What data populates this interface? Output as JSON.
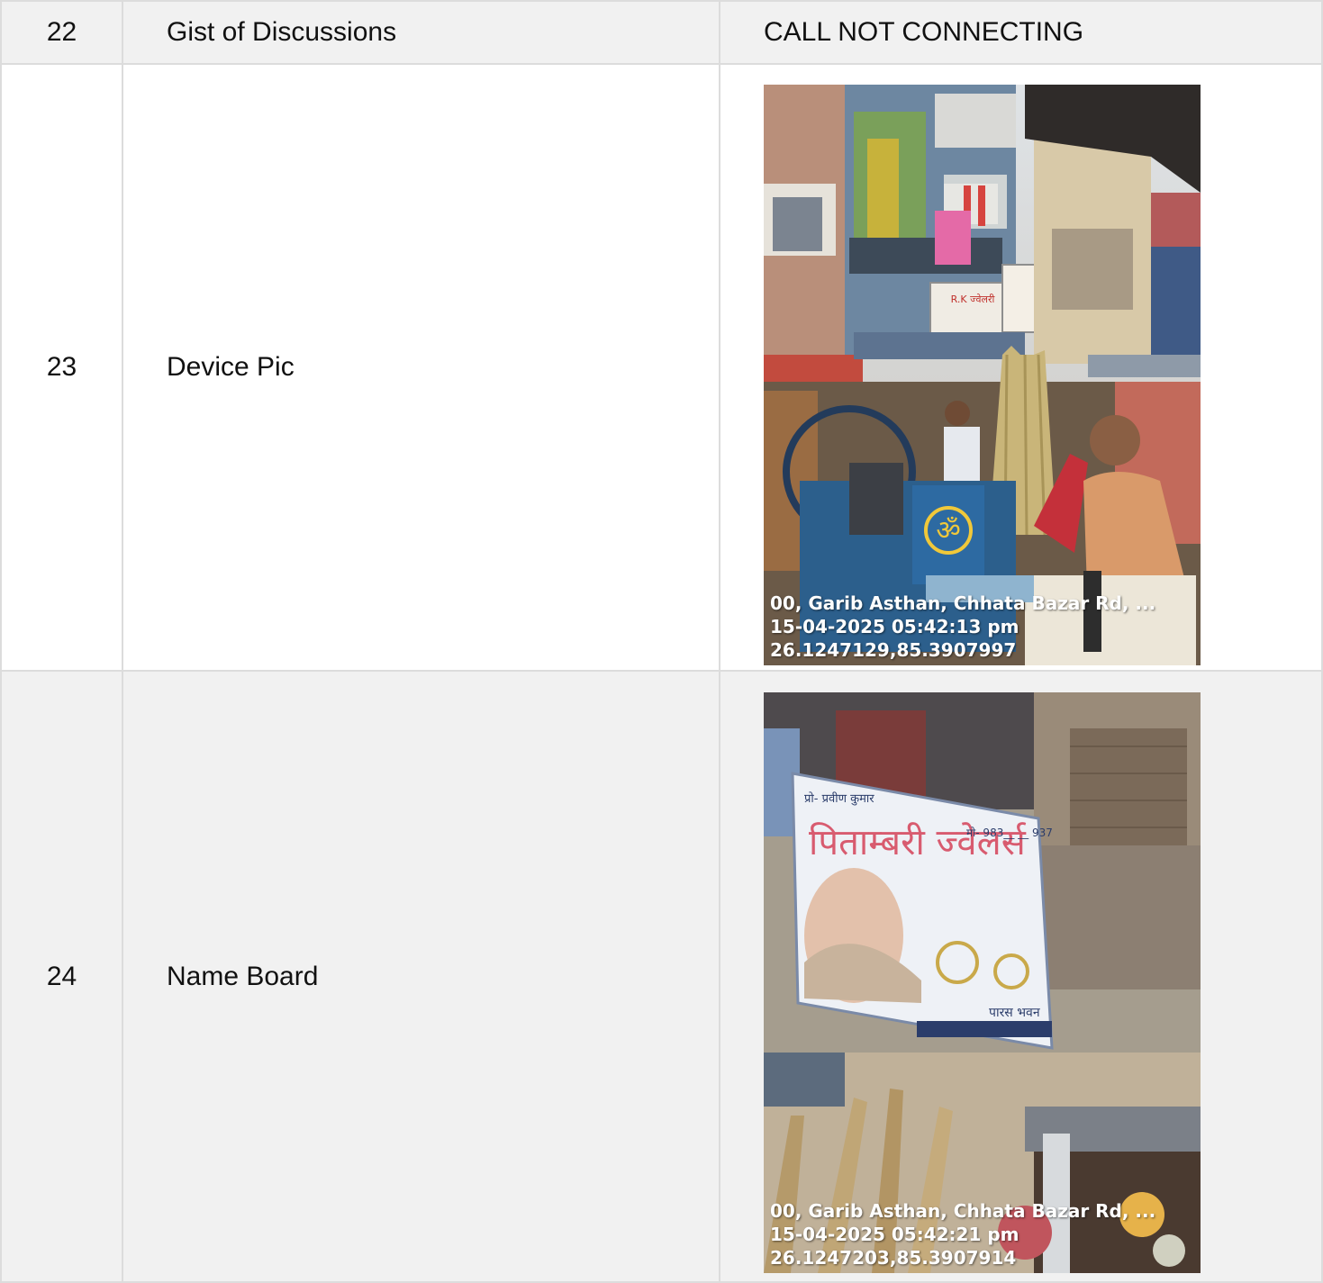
{
  "rows": [
    {
      "num": "22",
      "label": "Gist of Discussions",
      "value": "CALL NOT CONNECTING"
    },
    {
      "num": "23",
      "label": "Device Pic",
      "photo": {
        "stamp_lines": [
          "00, Garib Asthan, Chhata Bazar Rd, ...",
          "15-04-2025 05:42:13 pm",
          "26.1247129,85.3907997"
        ],
        "sign_texts": [
          "R.K ज्वेलरी",
          "ॐ"
        ]
      }
    },
    {
      "num": "24",
      "label": "Name Board",
      "photo": {
        "stamp_lines": [
          "00, Garib Asthan, Chhata Bazar Rd, ...",
          "15-04-2025 05:42:21 pm",
          "26.1247203,85.3907914"
        ],
        "sign_texts": [
          "प्रो- प्रवीण कुमार",
          "पिताम्बरी ज्वेलर्स",
          "मो- 983__ __ 937",
          "पारस भवन"
        ]
      }
    }
  ]
}
